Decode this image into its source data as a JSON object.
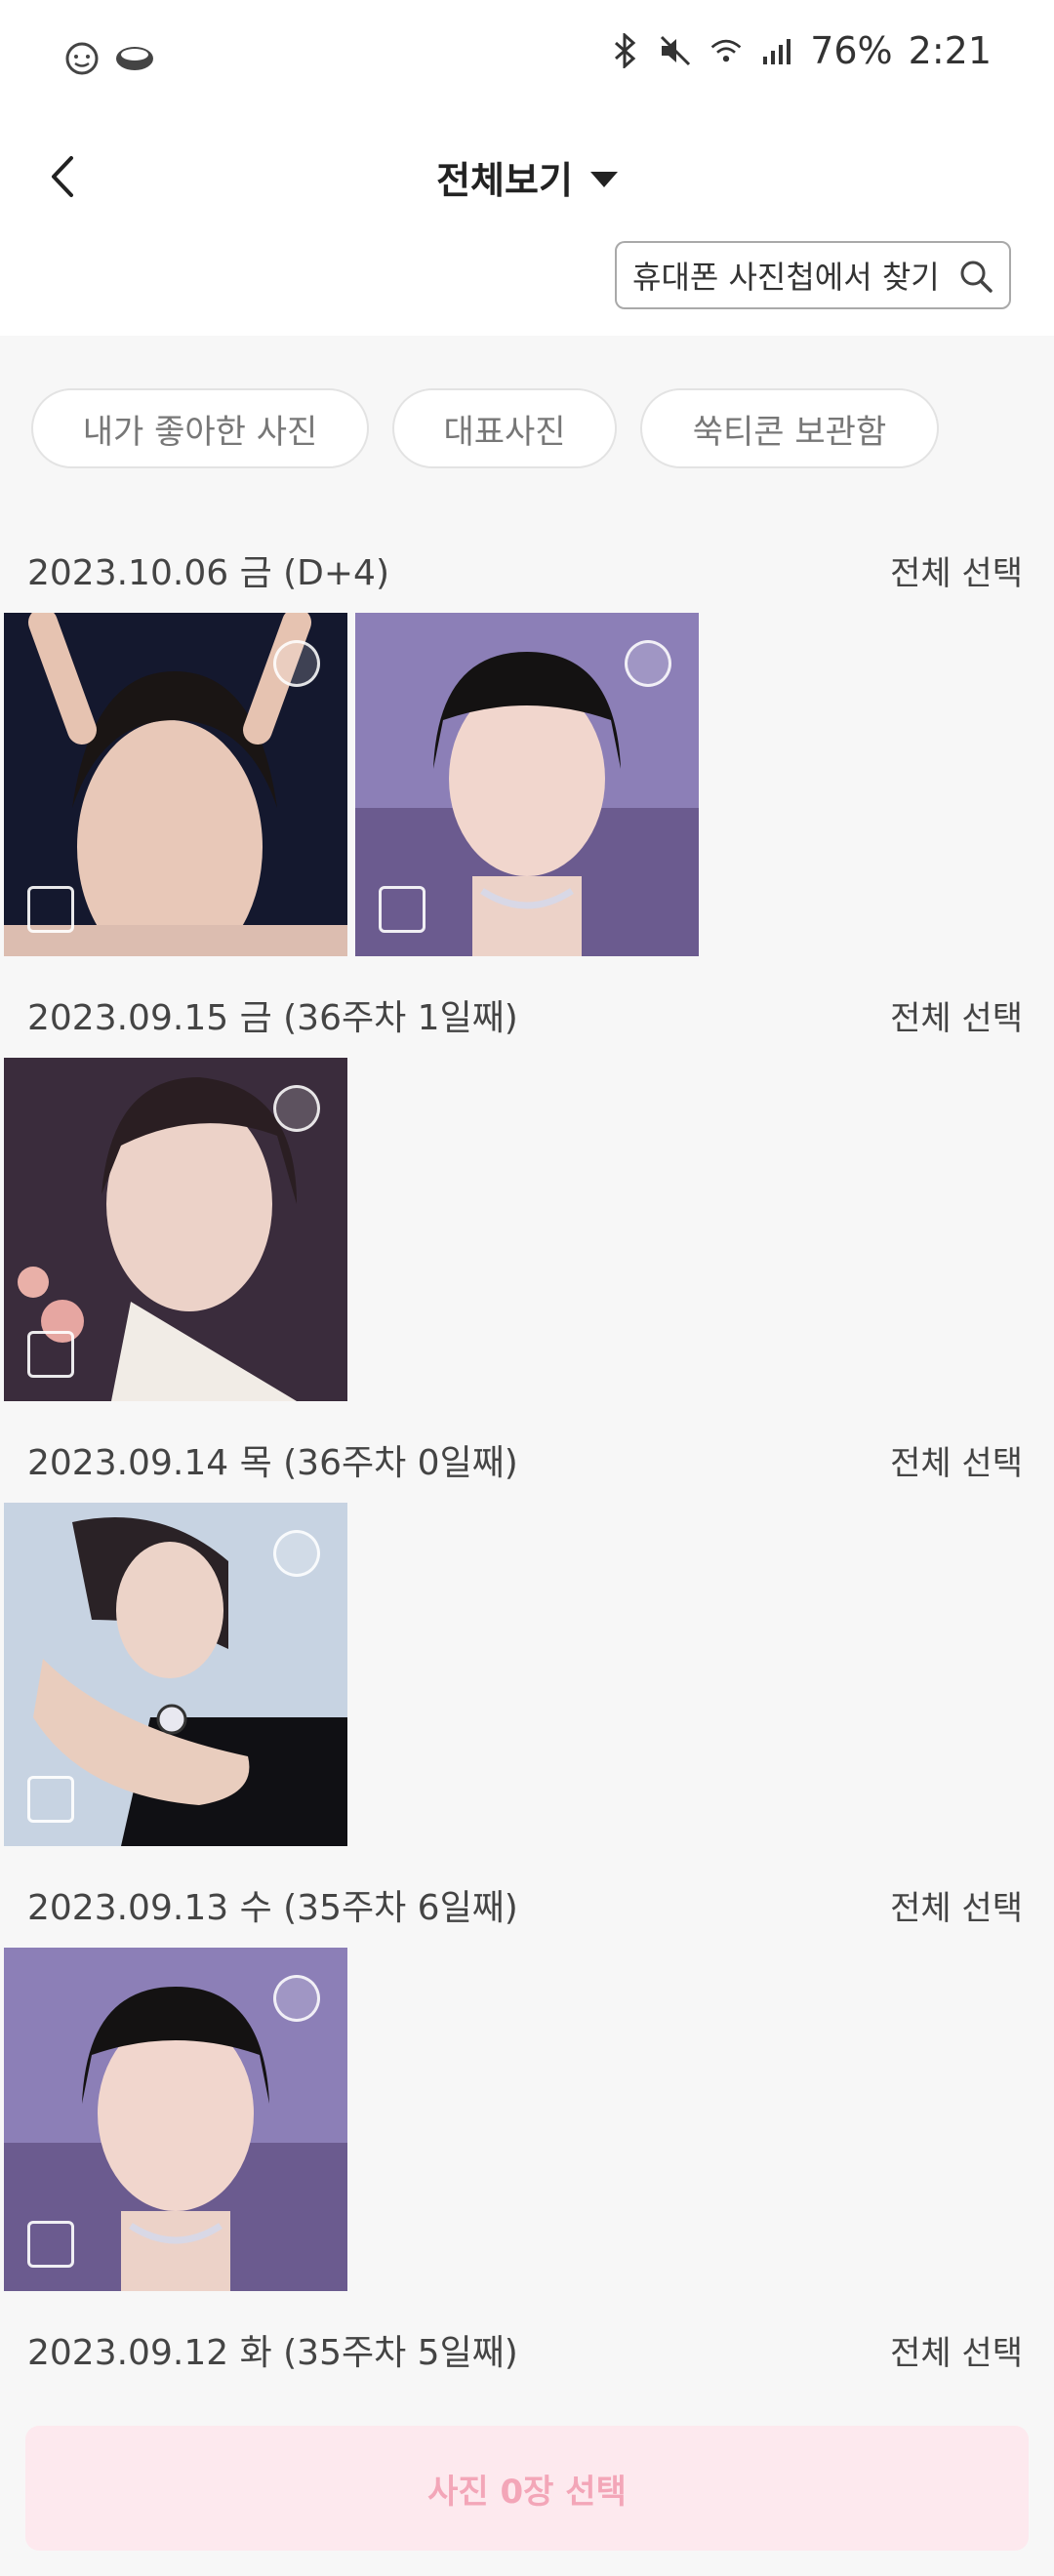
{
  "status_bar": {
    "battery": "76%",
    "time": "2:21"
  },
  "header": {
    "title": "전체보기"
  },
  "search": {
    "label": "휴대폰 사진첩에서 찾기"
  },
  "filters": [
    {
      "label": "내가 좋아한 사진"
    },
    {
      "label": "대표사진"
    },
    {
      "label": "쑥티콘 보관함"
    }
  ],
  "sections": [
    {
      "date": "2023.10.06 금 (D+4)",
      "select_all": "전체 선택",
      "photo_count": 2
    },
    {
      "date": "2023.09.15 금 (36주차 1일째)",
      "select_all": "전체 선택",
      "photo_count": 1
    },
    {
      "date": "2023.09.14 목 (36주차 0일째)",
      "select_all": "전체 선택",
      "photo_count": 1
    },
    {
      "date": "2023.09.13 수 (35주차 6일째)",
      "select_all": "전체 선택",
      "photo_count": 1
    },
    {
      "date": "2023.09.12 화 (35주차 5일째)",
      "select_all": "전체 선택",
      "photo_count": 0
    }
  ],
  "bottom_button": {
    "label": "사진 0장 선택"
  },
  "colors": {
    "accent_pink": "#f3a6b8",
    "button_bg": "#fde9ee"
  }
}
